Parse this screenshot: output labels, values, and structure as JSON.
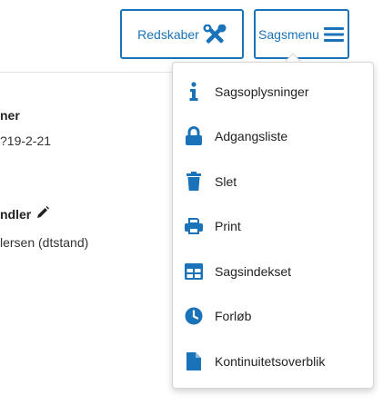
{
  "toolbar": {
    "redskaber_label": "Redskaber",
    "sagsmenu_label": "Sagsmenu"
  },
  "fields": [
    {
      "label": "ner",
      "value": "?19-2-21"
    },
    {
      "label": "ndler",
      "value": "lersen (dtstand)"
    }
  ],
  "menu": {
    "items": [
      {
        "label": "Sagsoplysninger",
        "icon": "info-icon"
      },
      {
        "label": "Adgangsliste",
        "icon": "lock-icon"
      },
      {
        "label": "Slet",
        "icon": "trash-icon"
      },
      {
        "label": "Print",
        "icon": "print-icon"
      },
      {
        "label": "Sagsindekset",
        "icon": "table-icon"
      },
      {
        "label": "Forløb",
        "icon": "clock-icon"
      },
      {
        "label": "Kontinuitetsoverblik",
        "icon": "file-icon"
      }
    ]
  },
  "colors": {
    "accent": "#1a73b8",
    "icon": "#1a73b8",
    "text": "#222222"
  }
}
